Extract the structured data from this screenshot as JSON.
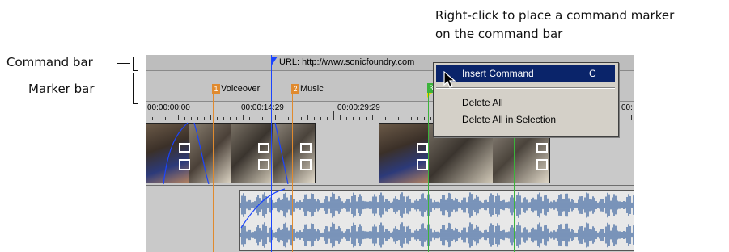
{
  "callout": {
    "line1": "Right-click to place a command marker",
    "line2": "on the command bar"
  },
  "labels": {
    "command_bar": "Command bar",
    "marker_bar": "Marker bar"
  },
  "command_bar": {
    "command_text": "URL: http://www.sonicfoundry.com"
  },
  "marker_bar": {
    "markers": [
      {
        "index": "1",
        "label": "Voiceover",
        "color": "#e08a2e"
      },
      {
        "index": "2",
        "label": "Music",
        "color": "#e08a2e"
      },
      {
        "index": "3",
        "label": "",
        "color": "#3bb33b"
      }
    ]
  },
  "ruler": {
    "times": [
      "00:00:00:00",
      "00:00:14:29",
      "00:00:29:29",
      "00:"
    ]
  },
  "context_menu": {
    "items": [
      {
        "label": "Insert Command",
        "mnemonic": "C",
        "key": "C",
        "selected": true
      },
      {
        "label": "Delete All",
        "mnemonic": "A",
        "key": "",
        "selected": false
      },
      {
        "label": "Delete All in Selection",
        "mnemonic": "S",
        "key": "",
        "selected": false
      }
    ]
  },
  "colors": {
    "selection": "#0a246a",
    "marker_orange": "#e08a2e",
    "marker_green": "#3bb33b",
    "cursor_blue": "#1a44ff",
    "waveform": "#4a6fa5"
  }
}
